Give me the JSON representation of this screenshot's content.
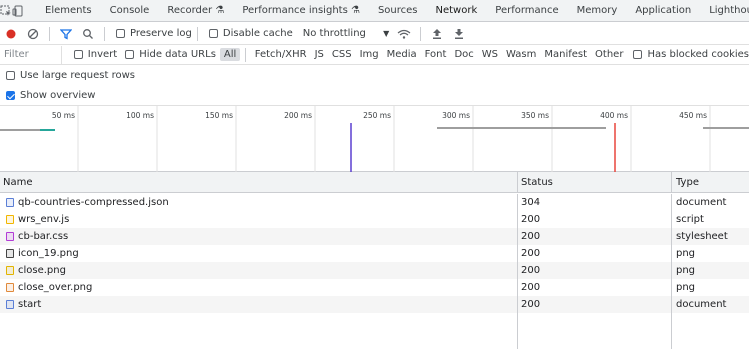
{
  "tabs": [
    {
      "label": "Elements"
    },
    {
      "label": "Console"
    },
    {
      "label": "Recorder"
    },
    {
      "label": "Performance insights"
    },
    {
      "label": "Sources"
    },
    {
      "label": "Network"
    },
    {
      "label": "Performance"
    },
    {
      "label": "Memory"
    },
    {
      "label": "Application"
    },
    {
      "label": "Lighthouse"
    }
  ],
  "active_tab": "Network",
  "toolbar": {
    "preserve_log": "Preserve log",
    "disable_cache": "Disable cache",
    "throttling": "No throttling",
    "preserve_log_checked": false,
    "disable_cache_checked": false
  },
  "filter": {
    "placeholder": "Filter",
    "invert": "Invert",
    "hide_data_urls": "Hide data URLs",
    "types": [
      "All",
      "Fetch/XHR",
      "JS",
      "CSS",
      "Img",
      "Media",
      "Font",
      "Doc",
      "WS",
      "Wasm",
      "Manifest",
      "Other"
    ],
    "active_type": "All",
    "has_blocked_cookies": "Has blocked cookies"
  },
  "options": {
    "large_rows": "Use large request rows",
    "large_rows_checked": false,
    "show_overview": "Show overview",
    "show_overview_checked": true
  },
  "overview": {
    "ticks": [
      "50 ms",
      "100 ms",
      "150 ms",
      "200 ms",
      "250 ms",
      "300 ms",
      "350 ms",
      "400 ms",
      "450 ms"
    ],
    "markers": {
      "dom_content_loaded_ms": 222,
      "load_ms": 388
    },
    "colors": {
      "dcl": "#5b3fd0",
      "load": "#e8453c",
      "bars": "#9e9e9e",
      "accent": "#26a69a"
    }
  },
  "table": {
    "headers": {
      "name": "Name",
      "status": "Status",
      "type": "Type"
    },
    "rows": [
      {
        "name": "qb-countries-compressed.json",
        "status": "304",
        "type": "document",
        "icon": "document-icon",
        "icon_color": "#5b7fd6"
      },
      {
        "name": "wrs_env.js",
        "status": "200",
        "type": "script",
        "icon": "script-icon",
        "icon_color": "#f2b600"
      },
      {
        "name": "cb-bar.css",
        "status": "200",
        "type": "stylesheet",
        "icon": "stylesheet-icon",
        "icon_color": "#b23bd6"
      },
      {
        "name": "icon_19.png",
        "status": "200",
        "type": "png",
        "icon": "image-icon",
        "icon_color": "#444444"
      },
      {
        "name": "close.png",
        "status": "200",
        "type": "png",
        "icon": "image-icon",
        "icon_color": "#e2b400"
      },
      {
        "name": "close_over.png",
        "status": "200",
        "type": "png",
        "icon": "image-icon",
        "icon_color": "#e08a3c"
      },
      {
        "name": "start",
        "status": "200",
        "type": "document",
        "icon": "document-icon",
        "icon_color": "#5b7fd6"
      }
    ]
  }
}
